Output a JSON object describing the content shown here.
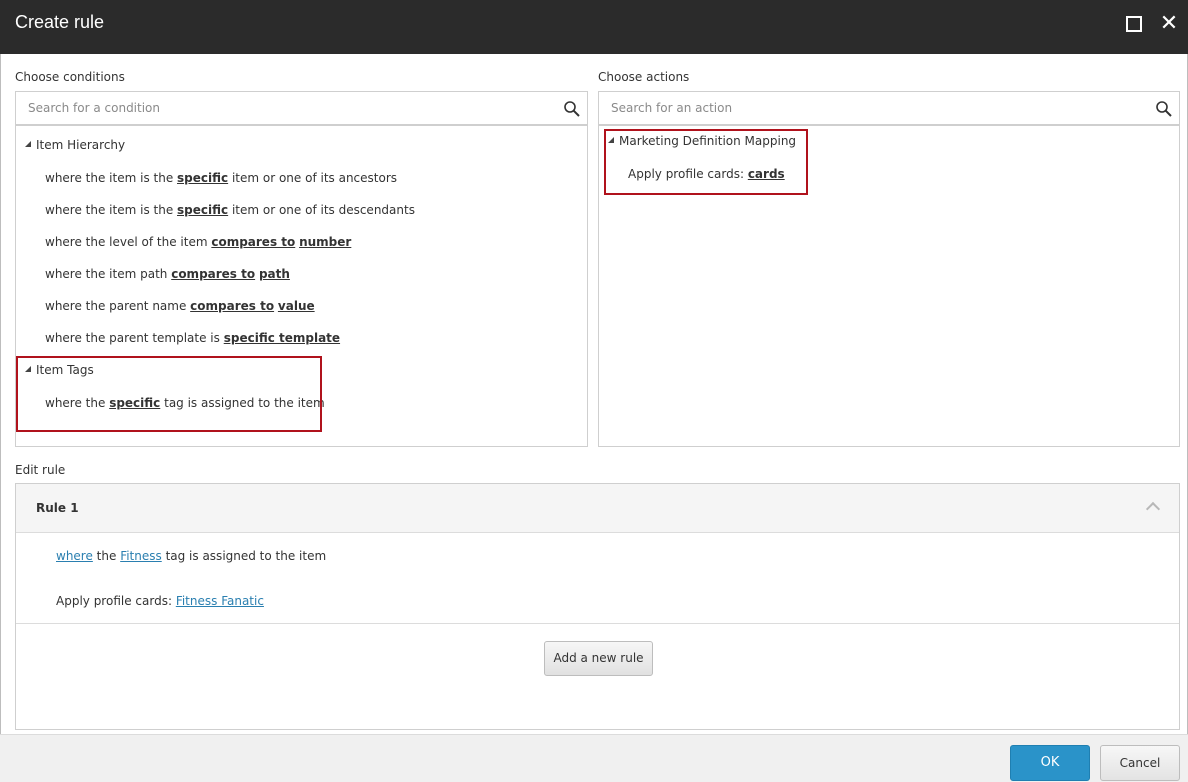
{
  "window": {
    "title": "Create rule"
  },
  "conditions": {
    "label": "Choose conditions",
    "search_placeholder": "Search for a condition",
    "groups": [
      {
        "name": "Item Hierarchy",
        "items": [
          {
            "pre": "where the item is the ",
            "k1": "specific",
            "mid": " item or one of its ancestors",
            "k2": "",
            "post": ""
          },
          {
            "pre": "where the item is the ",
            "k1": "specific",
            "mid": " item or one of its descendants",
            "k2": "",
            "post": ""
          },
          {
            "pre": "where the level of the item ",
            "k1": "compares to",
            "mid": " ",
            "k2": "number",
            "post": ""
          },
          {
            "pre": "where the item path ",
            "k1": "compares to",
            "mid": " ",
            "k2": "path",
            "post": ""
          },
          {
            "pre": "where the parent name ",
            "k1": "compares to",
            "mid": " ",
            "k2": "value",
            "post": ""
          },
          {
            "pre": "where the parent template is ",
            "k1": "specific template",
            "mid": "",
            "k2": "",
            "post": ""
          }
        ]
      },
      {
        "name": "Item Tags",
        "items": [
          {
            "pre": "where the ",
            "k1": "specific",
            "mid": " tag is assigned to the item",
            "k2": "",
            "post": ""
          }
        ]
      }
    ]
  },
  "actions": {
    "label": "Choose actions",
    "search_placeholder": "Search for an action",
    "groups": [
      {
        "name": "Marketing Definition Mapping",
        "items": [
          {
            "pre": "Apply profile cards: ",
            "k1": "cards"
          }
        ]
      }
    ]
  },
  "edit_rule": {
    "label": "Edit rule",
    "rule_name": "Rule 1",
    "condition": {
      "link1": "where",
      "t1": " the ",
      "link2": "Fitness",
      "t2": " tag is assigned to the item"
    },
    "action": {
      "t1": "Apply profile cards: ",
      "link1": "Fitness Fanatic"
    },
    "add_button": "Add a new rule"
  },
  "footer": {
    "ok": "OK",
    "cancel": "Cancel"
  },
  "colors": {
    "titlebar": "#2b2b2b",
    "highlight_box": "#b0121c",
    "link": "#2a7fb0",
    "ok_button": "#2a93c9"
  }
}
